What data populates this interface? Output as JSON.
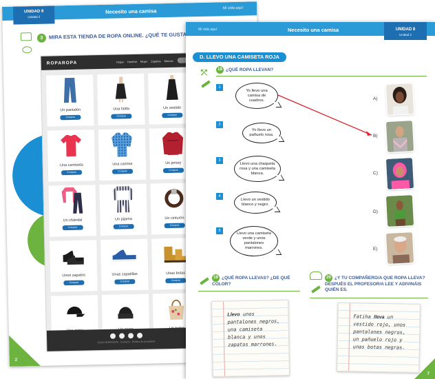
{
  "left_page": {
    "unit_label": "UNIDAD 8",
    "unit_sub": "Unidad 2",
    "title": "Necesito una camisa",
    "header_right": "Mi vida aquí",
    "activity_number": "3",
    "instruction": "MIRA ESTA TIENDA DE ROPA ONLINE. ¿QUÉ TE GUSTA Y QU",
    "page_number": "2"
  },
  "shop": {
    "logo": "ROPAROPA",
    "nav": [
      "Hogar",
      "Hombre",
      "Mujer",
      "Zapatos",
      "Marcas"
    ],
    "buy_label": "Comprar",
    "items": [
      {
        "name": "Un pantalón",
        "icon": "trousers-icon"
      },
      {
        "name": "Una falda",
        "icon": "skirt-icon"
      },
      {
        "name": "Un vestido",
        "icon": "dress-icon"
      },
      {
        "name": "Una camiseta",
        "icon": "tshirt-icon"
      },
      {
        "name": "Una camisa",
        "icon": "shirt-icon"
      },
      {
        "name": "Un jersey",
        "icon": "sweater-icon"
      },
      {
        "name": "Un chándal",
        "icon": "tracksuit-icon"
      },
      {
        "name": "Un pijama",
        "icon": "pajamas-icon"
      },
      {
        "name": "Un cinturón",
        "icon": "belt-icon"
      },
      {
        "name": "Unos zapatos",
        "icon": "shoes-icon"
      },
      {
        "name": "Unas zapatillas",
        "icon": "sneakers-icon"
      },
      {
        "name": "Unas botas",
        "icon": "boots-icon"
      },
      {
        "name": "Una gorra",
        "icon": "cap-icon"
      },
      {
        "name": "Un gorro",
        "icon": "beanie-icon"
      },
      {
        "name": "Un bolso",
        "icon": "handbag-icon"
      }
    ],
    "footer": "©2023 ROPAROPA ∙ Contacto ∙ Política de privacidad"
  },
  "right_page": {
    "header_left": "Mi vida aquí",
    "title": "Necesito una camisa",
    "unit_label": "UNIDAD 8",
    "unit_sub": "Unidad 2",
    "section": "D. LLEVO UNA CAMISETA ROJA",
    "q18_number": "18",
    "q18": "¿QUÉ ROPA LLEVAN?",
    "statements": [
      {
        "n": "1",
        "text": "Yo llevo una camisa de cuadros."
      },
      {
        "n": "2",
        "text": "Yo llevo un pañuelo rosa."
      },
      {
        "n": "3",
        "text": "Llevo una chaqueta rosa y una camiseta blanca."
      },
      {
        "n": "4",
        "text": "Llevo un vestido blanco y negro."
      },
      {
        "n": "5",
        "text": "Llevo una camiseta verde y unos pantalones marrones."
      }
    ],
    "options": [
      "A)",
      "B)",
      "C)",
      "D)",
      "E)"
    ],
    "q19_number": "19",
    "q19": "¿QUÉ ROPA LLEVAS? ¿DE QUÉ COLOR?",
    "q19_note_bold": "Llevo",
    "q19_note": "unos pantalones negros, una camiseta blanca y unos zapatos marrones.",
    "q20_number": "20",
    "q20": "¿Y TU COMPAÑERO/A QUE ROPA LLEVA? DESPUÉS EL PROFESOR/A LEE Y ADIVINÁIS QUIÉN ES.",
    "q20_note_start": "Fatiha",
    "q20_note_bold": "lleva",
    "q20_note": "un vestido rojo, unos pantalones negros, un pañuelo rojo y unas botas negras.",
    "page_number": "7",
    "colors": {
      "blue": "#1b8fd4",
      "green": "#6cb33f",
      "match_line": "#d9232b"
    }
  }
}
